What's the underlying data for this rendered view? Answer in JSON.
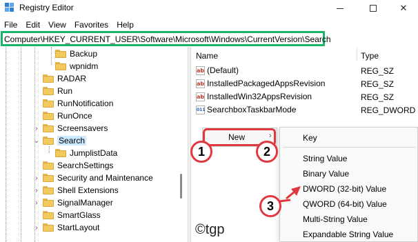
{
  "window": {
    "title": "Registry Editor",
    "minimize_icon": "minimize-icon",
    "maximize_icon": "maximize-icon",
    "close_glyph": "✕"
  },
  "menu": [
    "File",
    "Edit",
    "View",
    "Favorites",
    "Help"
  ],
  "address": "Computer\\HKEY_CURRENT_USER\\Software\\Microsoft\\Windows\\CurrentVersion\\Search",
  "tree": {
    "items": [
      {
        "label": "Backup"
      },
      {
        "label": "wpnidm"
      },
      {
        "label": "RADAR"
      },
      {
        "label": "Run"
      },
      {
        "label": "RunNotification"
      },
      {
        "label": "RunOnce"
      },
      {
        "label": "Screensavers"
      },
      {
        "label": "Search",
        "selected": true,
        "expanded": true
      },
      {
        "label": "JumplistData"
      },
      {
        "label": "SearchSettings"
      },
      {
        "label": "Security and Maintenance"
      },
      {
        "label": "Shell Extensions"
      },
      {
        "label": "SignalManager"
      },
      {
        "label": "SmartGlass"
      },
      {
        "label": "StartLayout"
      }
    ]
  },
  "values": {
    "headers": {
      "name": "Name",
      "type": "Type"
    },
    "rows": [
      {
        "name": "(Default)",
        "type": "REG_SZ",
        "icon": "string-value-icon"
      },
      {
        "name": "InstalledPackagedAppsRevision",
        "type": "REG_SZ",
        "icon": "string-value-icon"
      },
      {
        "name": "InstalledWin32AppsRevision",
        "type": "REG_SZ",
        "icon": "string-value-icon"
      },
      {
        "name": "SearchboxTaskbarMode",
        "type": "REG_DWORD",
        "icon": "dword-value-icon"
      }
    ]
  },
  "context_menu": {
    "new_label": "New",
    "arrow": "›"
  },
  "submenu": {
    "items": [
      "Key",
      "String Value",
      "Binary Value",
      "DWORD (32-bit) Value",
      "QWORD (64-bit) Value",
      "Multi-String Value",
      "Expandable String Value"
    ]
  },
  "annotations": {
    "badges": [
      "1",
      "2",
      "3"
    ],
    "color": "#e0383e"
  },
  "watermark": "©tgp",
  "colors": {
    "address_border": "#19b36b",
    "selection": "#cce8ff",
    "folder": "#f3c85e"
  }
}
